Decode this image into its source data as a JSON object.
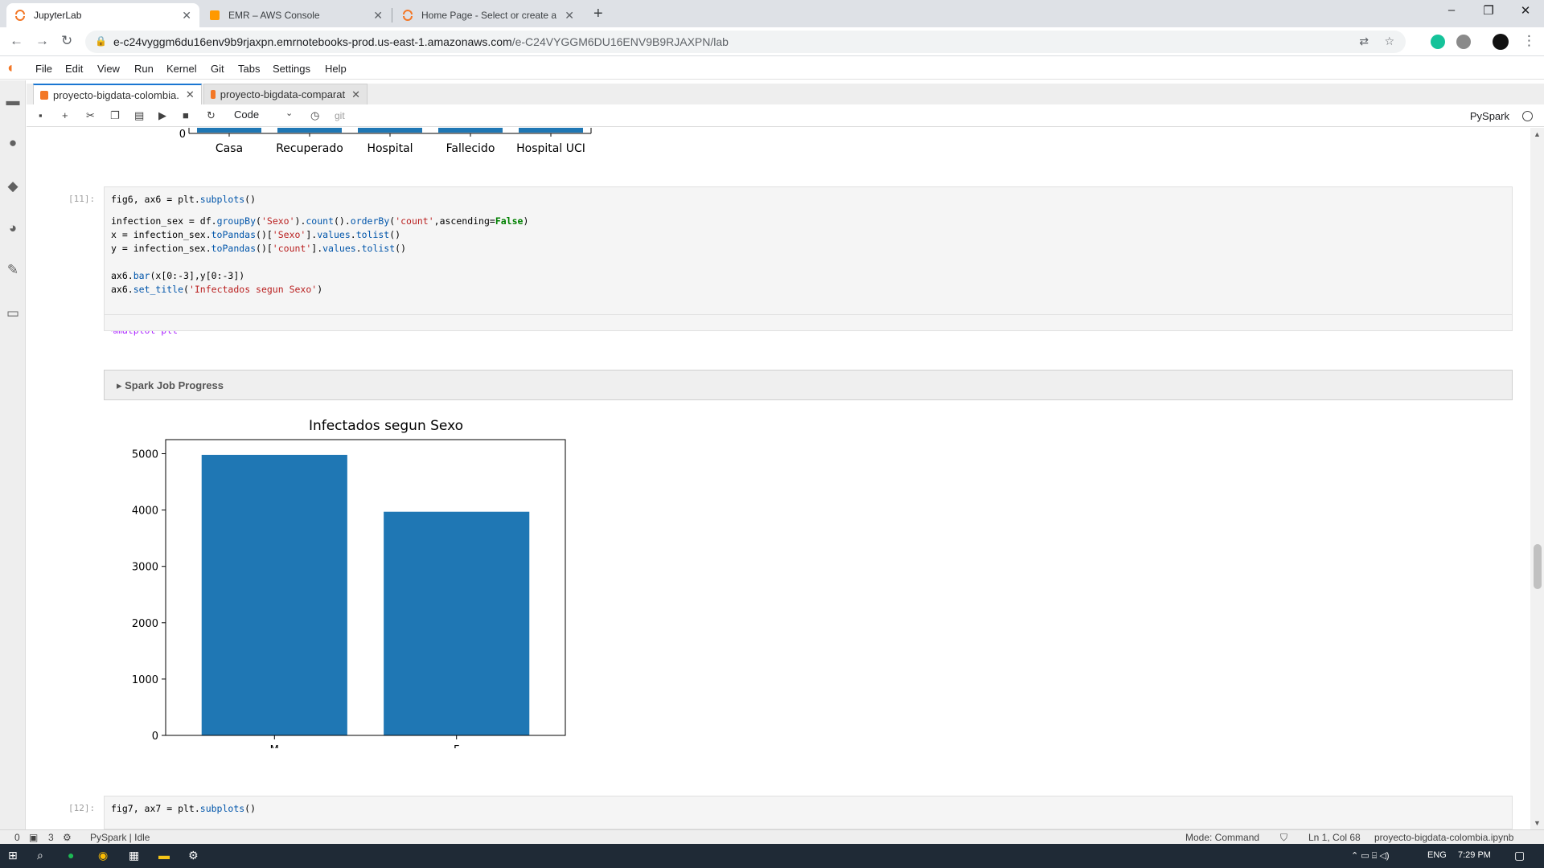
{
  "browser": {
    "tabs": [
      {
        "title": "JupyterLab",
        "active": true
      },
      {
        "title": "EMR – AWS Console",
        "active": false
      },
      {
        "title": "Home Page - Select or create a n",
        "active": false
      }
    ],
    "url_host": "e-c24vyggm6du16env9b9rjaxpn.emrnotebooks-prod.us-east-1.amazonaws.com",
    "url_path": "/e-C24VYGGM6DU16ENV9B9RJAXPN/lab"
  },
  "menu": [
    "File",
    "Edit",
    "View",
    "Run",
    "Kernel",
    "Git",
    "Tabs",
    "Settings",
    "Help"
  ],
  "doc_tabs": [
    {
      "title": "proyecto-bigdata-colombia.",
      "active": true
    },
    {
      "title": "proyecto-bigdata-comparat",
      "active": false
    }
  ],
  "notebook_toolbar": {
    "cell_type": "Code",
    "git_label": "git",
    "kernel": "PySpark"
  },
  "prev_chart": {
    "categories": [
      "Casa",
      "Recuperado",
      "Hospital",
      "Fallecido",
      "Hospital UCI"
    ],
    "zero_label": "0"
  },
  "cell11": {
    "prompt": "[11]:",
    "lines": [
      "fig6, ax6 = plt.subplots()",
      "infection_sex = df.groupBy('Sexo').count().orderBy('count',ascending=False)",
      "x = infection_sex.toPandas()['Sexo'].values.tolist()",
      "y = infection_sex.toPandas()['count'].values.tolist()",
      "ax6.bar(x[0:-3],y[0:-3])",
      "ax6.set_title('Infectados segun Sexo')",
      "%matplot plt"
    ],
    "spark_label": "Spark Job Progress"
  },
  "chart_data": {
    "type": "bar",
    "title": "Infectados segun Sexo",
    "categories": [
      "M",
      "F"
    ],
    "values": [
      4980,
      3970
    ],
    "ylim": [
      0,
      5250
    ],
    "yticks": [
      0,
      1000,
      2000,
      3000,
      4000,
      5000
    ],
    "bar_color": "#1f77b4",
    "grid": false
  },
  "cell12": {
    "prompt": "[12]:",
    "line": "fig7, ax7 = plt.subplots()"
  },
  "statusbar": {
    "left_count": "0",
    "terminals": "3",
    "kernel_status": "PySpark | Idle",
    "mode": "Mode: Command",
    "position": "Ln 1, Col 68",
    "filename": "proyecto-bigdata-colombia.ipynb"
  },
  "taskbar": {
    "lang": "ENG",
    "time": "7:29 PM"
  },
  "colors": {
    "jupyter_orange": "#f37726",
    "accent_blue": "#1976d2"
  }
}
